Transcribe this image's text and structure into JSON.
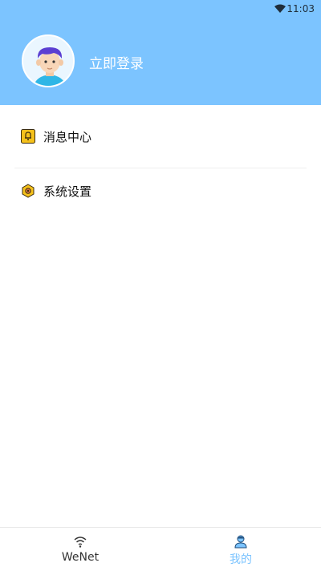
{
  "status_bar": {
    "time": "11:03"
  },
  "profile": {
    "login_label": "立即登录"
  },
  "menu": [
    {
      "label": "消息中心",
      "icon": "bell-icon"
    },
    {
      "label": "系统设置",
      "icon": "settings-icon"
    }
  ],
  "tabbar": {
    "tabs": [
      {
        "label": "WeNet",
        "icon": "wifi-icon",
        "active": false
      },
      {
        "label": "我的",
        "icon": "user-icon",
        "active": true
      }
    ]
  },
  "colors": {
    "header_bg": "#7cc4ff",
    "accent": "#7cc4ff",
    "text": "#111111"
  }
}
